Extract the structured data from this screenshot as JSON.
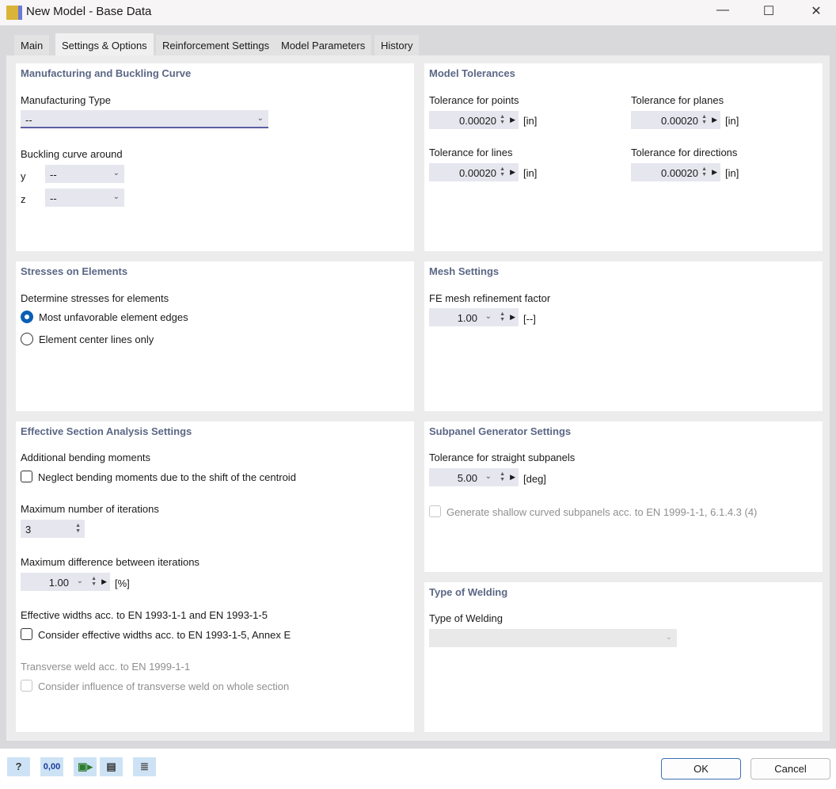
{
  "window": {
    "title": "New Model - Base Data",
    "minimize": "—",
    "maximize": "☐",
    "close": "✕"
  },
  "tabs": [
    "Main",
    "Settings & Options",
    "Reinforcement Settings",
    "Model Parameters",
    "History"
  ],
  "manufacturing": {
    "heading": "Manufacturing and Buckling Curve",
    "type_label": "Manufacturing Type",
    "type_value": "--",
    "buckling_label": "Buckling curve around",
    "y_label": "y",
    "y_value": "--",
    "z_label": "z",
    "z_value": "--"
  },
  "tolerances": {
    "heading": "Model Tolerances",
    "points_label": "Tolerance for points",
    "points_value": "0.00020",
    "planes_label": "Tolerance for planes",
    "planes_value": "0.00020",
    "lines_label": "Tolerance for lines",
    "lines_value": "0.00020",
    "directions_label": "Tolerance for directions",
    "directions_value": "0.00020",
    "unit": "[in]"
  },
  "stresses": {
    "heading": "Stresses on Elements",
    "label": "Determine stresses for elements",
    "option1": "Most unfavorable element edges",
    "option2": "Element center lines only"
  },
  "mesh": {
    "heading": "Mesh Settings",
    "label": "FE mesh refinement factor",
    "value": "1.00",
    "unit": "[--]"
  },
  "effective": {
    "heading": "Effective Section Analysis Settings",
    "bending_label": "Additional bending moments",
    "bending_check": "Neglect bending moments due to the shift of the centroid",
    "iter_label": "Maximum number of iterations",
    "iter_value": "3",
    "diff_label": "Maximum difference between iterations",
    "diff_value": "1.00",
    "diff_unit": "[%]",
    "widths_label": "Effective widths acc. to EN 1993-1-1 and EN 1993-1-5",
    "widths_check": "Consider effective widths acc. to EN 1993-1-5, Annex E",
    "weld_label": "Transverse weld acc. to EN 1999-1-1",
    "weld_check": "Consider influence of transverse weld on whole section"
  },
  "subpanel": {
    "heading": "Subpanel Generator Settings",
    "label": "Tolerance for straight subpanels",
    "value": "5.00",
    "unit": "[deg]",
    "check": "Generate shallow curved subpanels acc. to EN 1999-1-1, 6.1.4.3 (4)"
  },
  "welding": {
    "heading": "Type of Welding",
    "label": "Type of Welding"
  },
  "footer": {
    "ok": "OK",
    "cancel": "Cancel",
    "units_icon": "0,00"
  }
}
